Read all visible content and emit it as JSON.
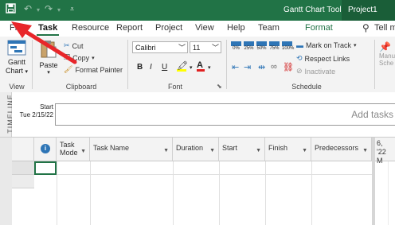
{
  "titlebar": {
    "save_icon": "save-icon",
    "undo_icon": "undo-icon",
    "redo_icon": "redo-icon",
    "customize_icon": "customize-qat-icon",
    "context_label": "Gantt Chart Tools",
    "window_title": "Project1"
  },
  "tabs": {
    "file": "File",
    "task": "Task",
    "resource": "Resource",
    "report": "Report",
    "project": "Project",
    "view": "View",
    "help": "Help",
    "team": "Team",
    "format": "Format",
    "tell_me": "Tell m"
  },
  "ribbon": {
    "view_group": {
      "gantt_line1": "Gantt",
      "gantt_line2": "Chart",
      "label": "View"
    },
    "clipboard": {
      "paste": "Paste",
      "cut": "Cut",
      "copy": "Copy",
      "format_painter": "Format Painter",
      "label": "Clipboard"
    },
    "font": {
      "family": "Calibri",
      "size": "11",
      "bold": "B",
      "italic": "I",
      "underline": "U",
      "label": "Font"
    },
    "schedule": {
      "pct": [
        "0%",
        "25%",
        "50%",
        "75%",
        "100%"
      ],
      "mark_on_track": "Mark on Track",
      "respect_links": "Respect Links",
      "inactivate": "Inactivate",
      "label": "Schedule"
    },
    "cutoff": {
      "line1": "Manu",
      "line2": "Sche"
    }
  },
  "timeline": {
    "side_label": "TIMELINE",
    "start_label": "Start",
    "start_date": "Tue 2/15/22",
    "add_tasks": "Add tasks w"
  },
  "grid": {
    "info_icon": "info-icon",
    "headers": {
      "task_mode_1": "Task",
      "task_mode_2": "Mode",
      "task_name": "Task Name",
      "duration": "Duration",
      "start": "Start",
      "finish": "Finish",
      "predecessors": "Predecessors"
    },
    "gantt_header": {
      "line1": "6, '22",
      "line2": "M"
    }
  }
}
